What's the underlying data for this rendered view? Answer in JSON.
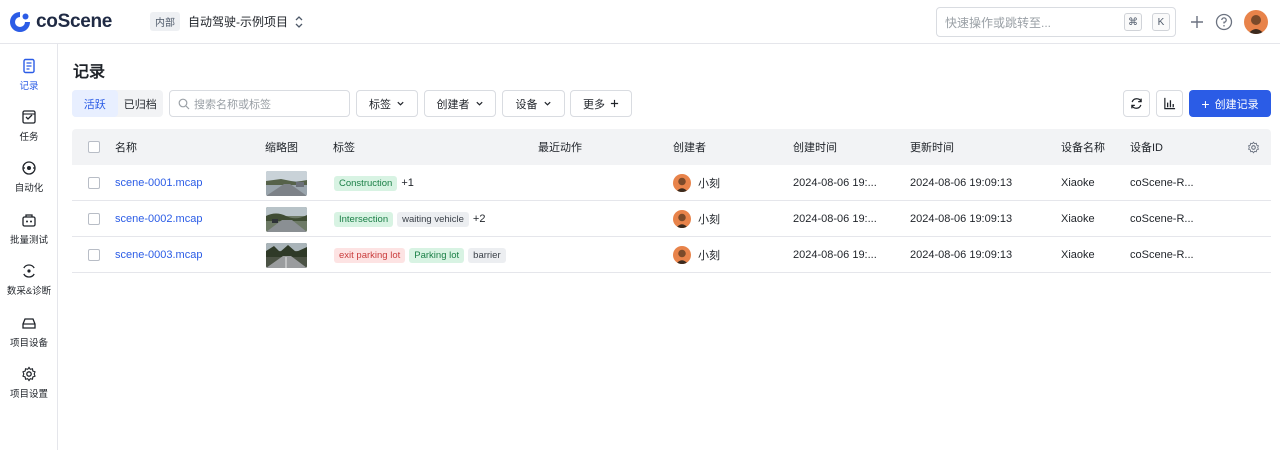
{
  "app": {
    "brand": "coScene",
    "project_badge": "内部",
    "project_name": "自动驾驶-示例项目"
  },
  "topbar": {
    "search_placeholder": "快速操作或跳转至...",
    "kbd_cmd": "⌘",
    "kbd_k": "K"
  },
  "sidebar": {
    "items": [
      {
        "label": "记录",
        "icon": "record-icon"
      },
      {
        "label": "任务",
        "icon": "task-icon"
      },
      {
        "label": "自动化",
        "icon": "automation-icon"
      },
      {
        "label": "批量测试",
        "icon": "batch-test-icon"
      },
      {
        "label": "数采&诊断",
        "icon": "diagnosis-icon"
      },
      {
        "label": "项目设备",
        "icon": "device-icon"
      },
      {
        "label": "项目设置",
        "icon": "settings-icon"
      }
    ]
  },
  "main": {
    "title": "记录",
    "tabs": [
      {
        "label": "活跃"
      },
      {
        "label": "已归档"
      }
    ],
    "search_placeholder": "搜索名称或标签",
    "filters": {
      "tags": "标签",
      "creator": "创建者",
      "device": "设备",
      "more": "更多"
    },
    "create_button": "创建记录"
  },
  "table": {
    "columns": [
      "名称",
      "缩略图",
      "标签",
      "最近动作",
      "创建者",
      "创建时间",
      "更新时间",
      "设备名称",
      "设备ID"
    ],
    "rows": [
      {
        "name": "scene-0001.mcap",
        "tags": [
          {
            "text": "Construction",
            "color": "green"
          }
        ],
        "more_tags": "+1",
        "creator": "小刻",
        "created": "2024-08-06 19:...",
        "updated": "2024-08-06 19:09:13",
        "device_name": "Xiaoke",
        "device_id": "coScene-R..."
      },
      {
        "name": "scene-0002.mcap",
        "tags": [
          {
            "text": "Intersection",
            "color": "green"
          },
          {
            "text": "waiting vehicle",
            "color": "gray"
          }
        ],
        "more_tags": "+2",
        "creator": "小刻",
        "created": "2024-08-06 19:...",
        "updated": "2024-08-06 19:09:13",
        "device_name": "Xiaoke",
        "device_id": "coScene-R..."
      },
      {
        "name": "scene-0003.mcap",
        "tags": [
          {
            "text": "exit parking lot",
            "color": "red"
          },
          {
            "text": "Parking lot",
            "color": "green"
          },
          {
            "text": "barrier",
            "color": "gray"
          }
        ],
        "more_tags": "",
        "creator": "小刻",
        "created": "2024-08-06 19:...",
        "updated": "2024-08-06 19:09:13",
        "device_name": "Xiaoke",
        "device_id": "coScene-R..."
      }
    ]
  },
  "colors": {
    "primary": "#2b5ce6",
    "tag_green_bg": "#d8f3e3",
    "tag_red_bg": "#fde3e3",
    "tag_gray_bg": "#eceef1"
  }
}
